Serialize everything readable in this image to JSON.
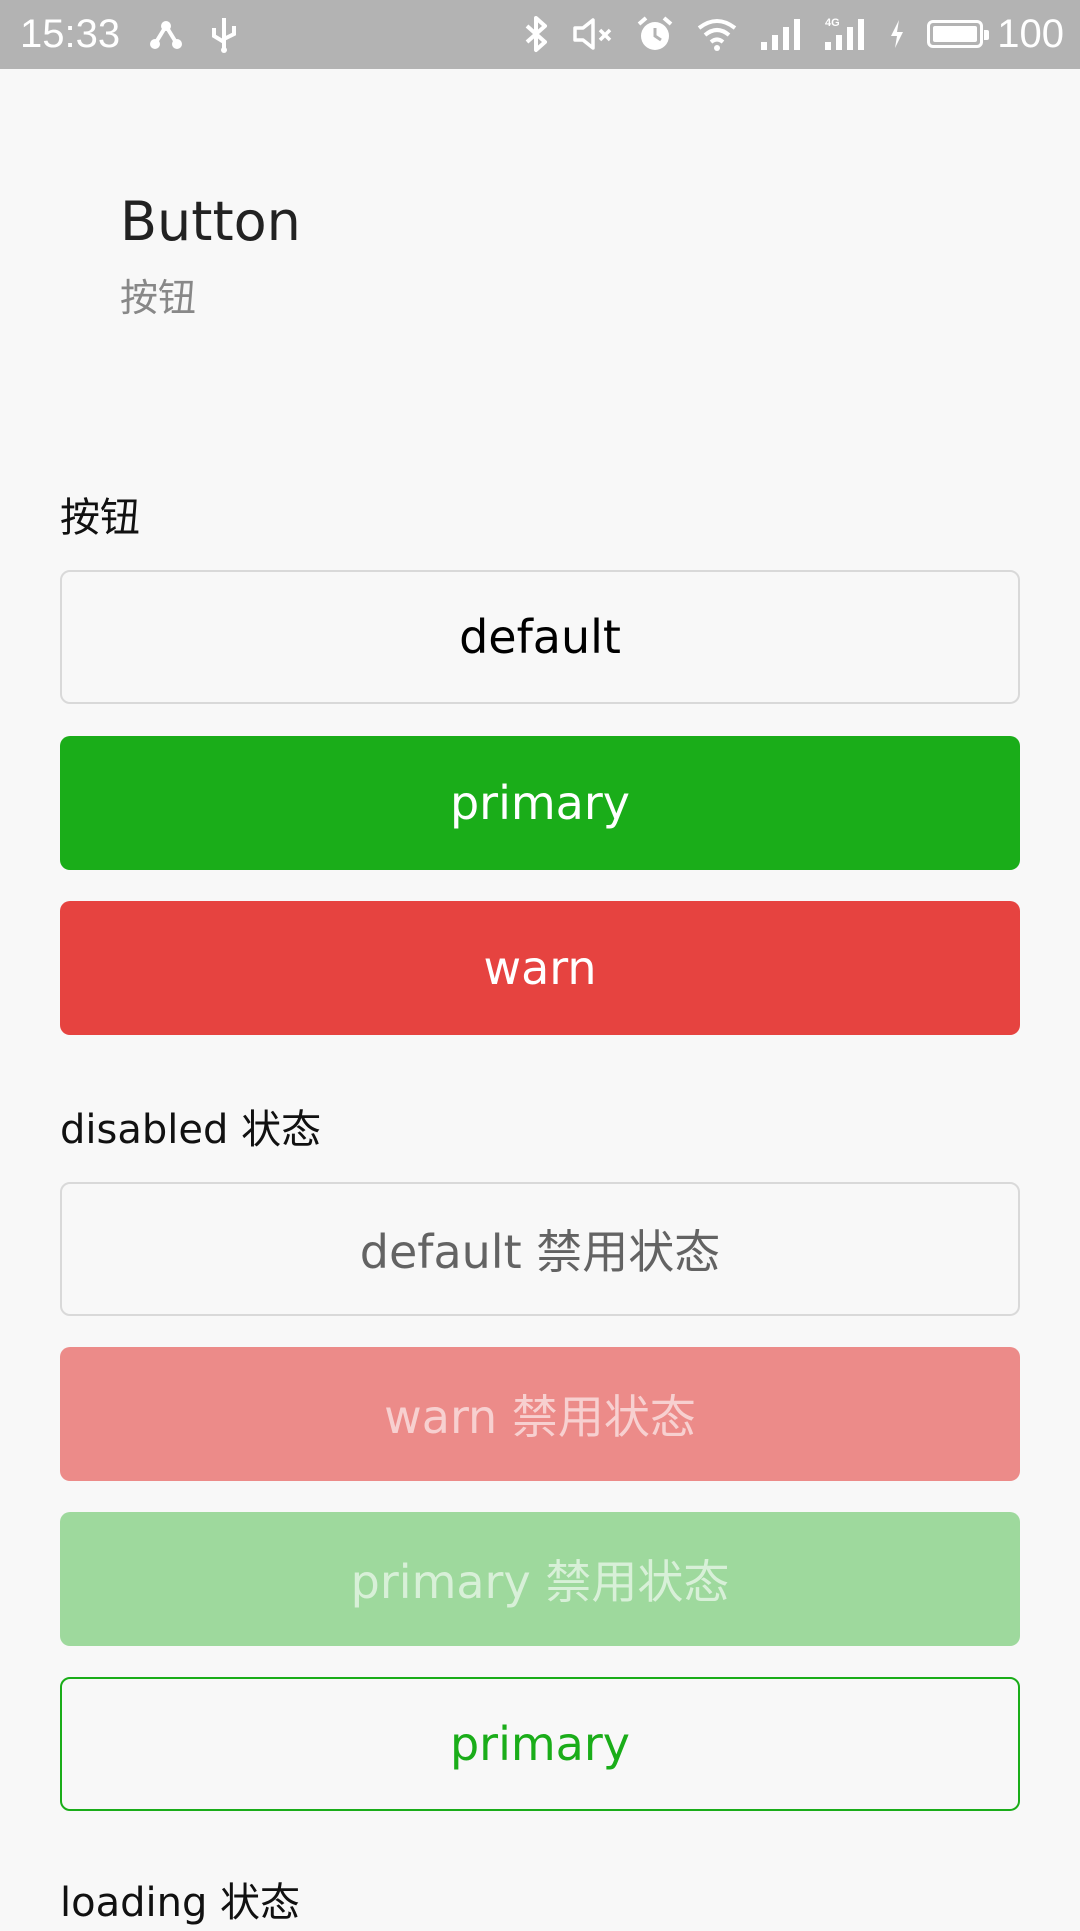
{
  "status_bar": {
    "time": "15:33",
    "battery": "100",
    "battery_level": 1.0,
    "left_icons": [
      "share-icon",
      "usb-icon"
    ],
    "right_icons": [
      "bluetooth-icon",
      "mute-icon",
      "alarm-icon",
      "wifi-icon",
      "signal-icon",
      "signal-4g-icon",
      "charging-icon"
    ]
  },
  "header": {
    "title": "Button",
    "desc": "按钮"
  },
  "sections": {
    "buttons_title": "按钮",
    "disabled_title": "disabled 状态",
    "loading_title": "loading 状态"
  },
  "buttons": {
    "default": "default",
    "primary": "primary",
    "warn": "warn",
    "default_disabled": "default 禁用状态",
    "warn_disabled": "warn 禁用状态",
    "primary_disabled": "primary 禁用状态",
    "primary_plain": "primary"
  },
  "colors": {
    "primary": "#1aad19",
    "warn": "#e64340",
    "status_bar_bg": "#b3b3b3",
    "page_bg": "#f8f8f8"
  }
}
